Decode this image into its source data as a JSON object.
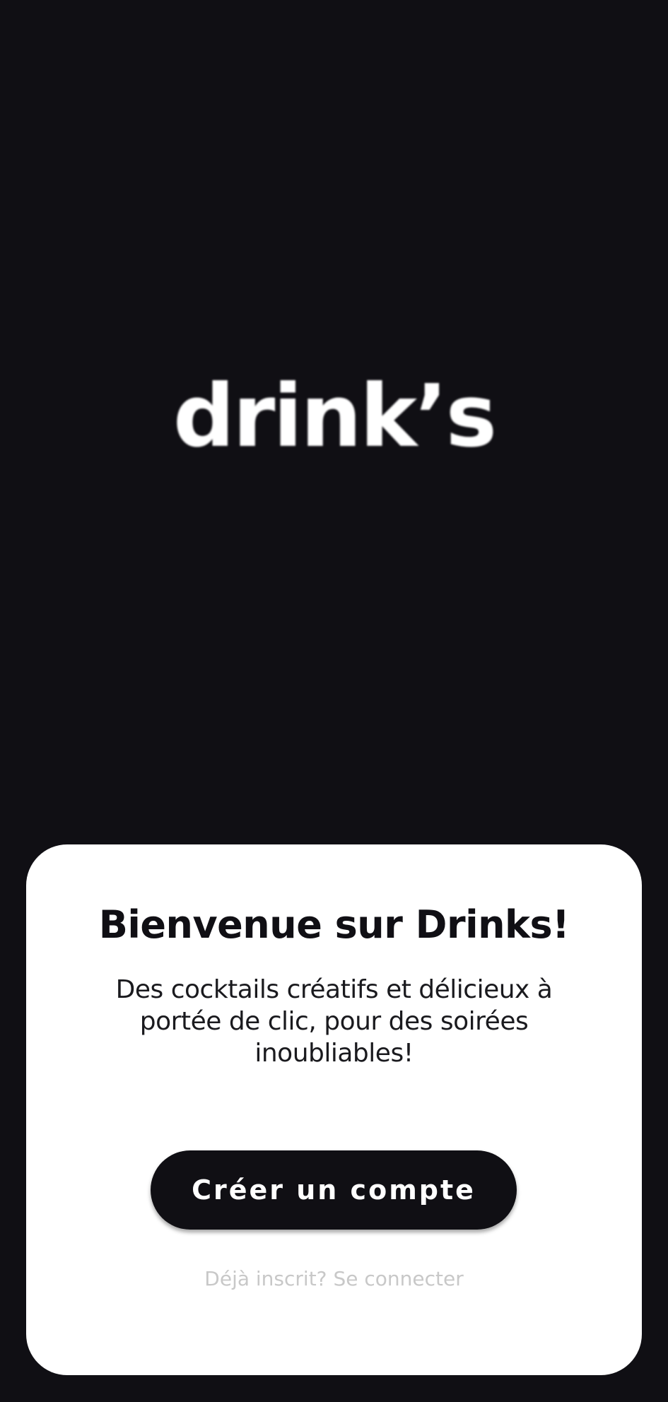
{
  "app": {
    "logo_text": "drink’s"
  },
  "welcome_card": {
    "title": "Bienvenue sur Drinks!",
    "subtitle": "Des cocktails créatifs et délicieux à portée de clic, pour des soirées inoubliables!",
    "primary_button_label": "Créer un compte",
    "secondary_link_label": "Déjà inscrit? Se connecter"
  },
  "colors": {
    "background": "#100f14",
    "card": "#ffffff",
    "button": "#100f14",
    "link": "#c8c8c8"
  }
}
